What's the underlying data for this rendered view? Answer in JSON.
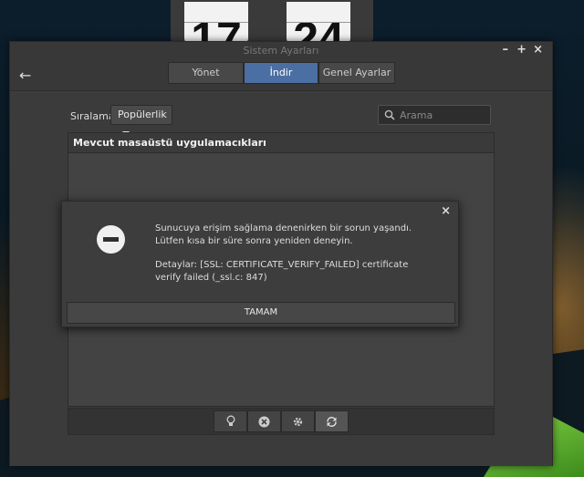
{
  "clock": {
    "hour": "17",
    "minute": "24"
  },
  "window": {
    "title": "Sistem Ayarları",
    "controls": {
      "minimize": "–",
      "maximize": "+",
      "close": "×"
    }
  },
  "toolbar": {
    "back": "←",
    "tabs": [
      {
        "label": "Yönet",
        "active": false
      },
      {
        "label": "İndir",
        "active": true
      },
      {
        "label": "Genel Ayarlar",
        "active": false
      }
    ]
  },
  "filters": {
    "sort_label": "Sıralama",
    "sort_value": "Popülerlik",
    "search_placeholder": "Arama"
  },
  "panel": {
    "heading": "Mevcut masaüstü uygulamacıkları"
  },
  "bottom_buttons": [
    {
      "icon": "lightbulb-icon"
    },
    {
      "icon": "cancel-icon"
    },
    {
      "icon": "gear-icon"
    },
    {
      "icon": "refresh-icon",
      "active": true
    }
  ],
  "dialog": {
    "close": "×",
    "icon": "error-icon",
    "message": "Sunucuya erişim sağlama denenirken bir sorun yaşandı. Lütfen kısa bir süre sonra yeniden deneyin.",
    "details": "Detaylar: [SSL: CERTIFICATE_VERIFY_FAILED] certificate verify failed (_ssl.c: 847)",
    "ok_label": "TAMAM"
  },
  "colors": {
    "accent": "#4b6ea3",
    "window_bg": "#3d3d3d"
  }
}
